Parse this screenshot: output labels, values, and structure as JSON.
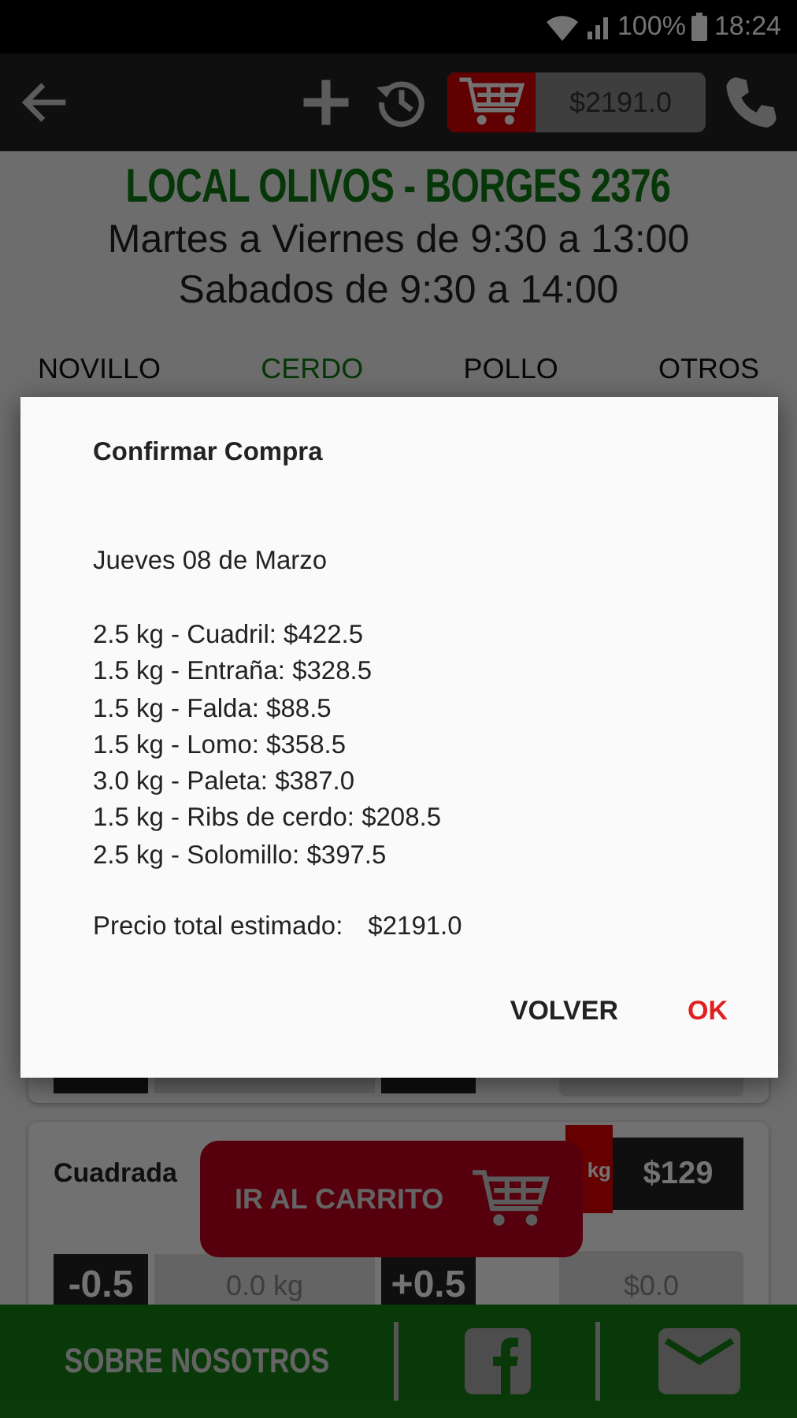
{
  "status_bar": {
    "battery": "100%",
    "time": "18:24"
  },
  "toolbar": {
    "cart_total": "$2191.0"
  },
  "store": {
    "name": "LOCAL OLIVOS - BORGES 2376",
    "hours": [
      "Martes a Viernes de 9:30 a 13:00",
      "Sabados de 9:30 a 14:00"
    ]
  },
  "tabs": [
    {
      "label": "NOVILLO",
      "selected": false
    },
    {
      "label": "CERDO",
      "selected": true
    },
    {
      "label": "POLLO",
      "selected": false
    },
    {
      "label": "OTROS",
      "selected": false
    }
  ],
  "products": [
    {
      "name": "Cuadrada",
      "unit": "kg",
      "price": "$129",
      "decrement": "-0.5",
      "quantity": "0.0 kg",
      "increment": "+0.5",
      "subtotal": "$0.0"
    }
  ],
  "floating_button": {
    "label": "IR AL CARRITO"
  },
  "footer": {
    "about": "SOBRE NOSOTROS"
  },
  "dialog": {
    "title": "Confirmar Compra",
    "date": "Jueves 08 de Marzo",
    "items": [
      "2.5 kg - Cuadril: $422.5",
      "1.5 kg - Entraña: $328.5",
      "1.5 kg - Falda: $88.5",
      "1.5 kg - Lomo: $358.5",
      "3.0 kg - Paleta: $387.0",
      "1.5 kg - Ribs de cerdo: $208.5",
      "2.5 kg - Solomillo: $397.5"
    ],
    "total_label": "Precio total estimado:",
    "total": "$2191.0",
    "buttons": [
      {
        "label": "VOLVER",
        "kind": "neutral"
      },
      {
        "label": "OK",
        "kind": "primary"
      }
    ]
  }
}
